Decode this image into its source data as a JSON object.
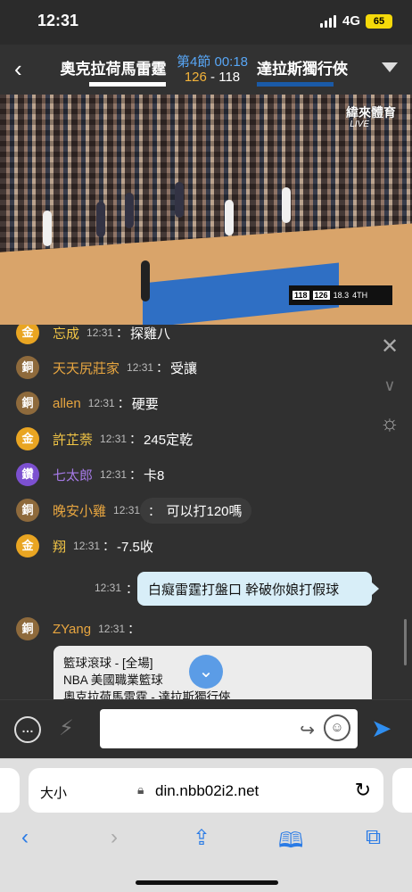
{
  "status": {
    "time": "12:31",
    "network": "4G",
    "battery": "65"
  },
  "game": {
    "home_team": "奧克拉荷馬雷霆",
    "away_team": "達拉斯獨行俠",
    "quarter": "第4節 00:18",
    "home_score": "126",
    "away_score": "118",
    "score_sep": " - "
  },
  "video": {
    "broadcaster": "緯來體育",
    "live": "LIVE",
    "bug_score_away": "118",
    "bug_score_home": "126",
    "bug_time": "18.3",
    "bug_period": "4TH"
  },
  "chat": {
    "messages": [
      {
        "badge": "金",
        "user": "忘成",
        "time": "12:31",
        "sep": "：",
        "text": "探雞八"
      },
      {
        "badge": "銅",
        "user": "天天尻莊家",
        "time": "12:31",
        "sep": "：",
        "text": "受讓"
      },
      {
        "badge": "銅",
        "user": "allen",
        "time": "12:31",
        "sep": "：",
        "text": "硬要"
      },
      {
        "badge": "金",
        "user": "許芷萘",
        "time": "12:31",
        "sep": "：",
        "text": "245定乾"
      },
      {
        "badge": "鑽",
        "user": "七太郎",
        "time": "12:31",
        "sep": "：",
        "text": "卡8"
      },
      {
        "badge": "銅",
        "user": "晚安小雞",
        "time": "12:31",
        "sep": "：",
        "text": "可以打120嗎"
      },
      {
        "badge": "金",
        "user": "翔",
        "time": "12:31",
        "sep": "：",
        "text": "-7.5收"
      },
      {
        "badge": "銅",
        "user": "ZYang",
        "time": "12:31",
        "sep": "：",
        "text": ""
      }
    ],
    "my_message": {
      "time": "12:31",
      "sep": "：",
      "text": "白癡雷霆打盤口 幹破你娘打假球"
    },
    "card": {
      "line1": "籃球滾球 - [全場]",
      "line2": "NBA 美國職業籃球",
      "line3": "奧克拉荷馬雷霆 - 達拉斯獨行俠"
    }
  },
  "browser": {
    "text_size": "大小",
    "url": "din.nbb02i2.net"
  }
}
